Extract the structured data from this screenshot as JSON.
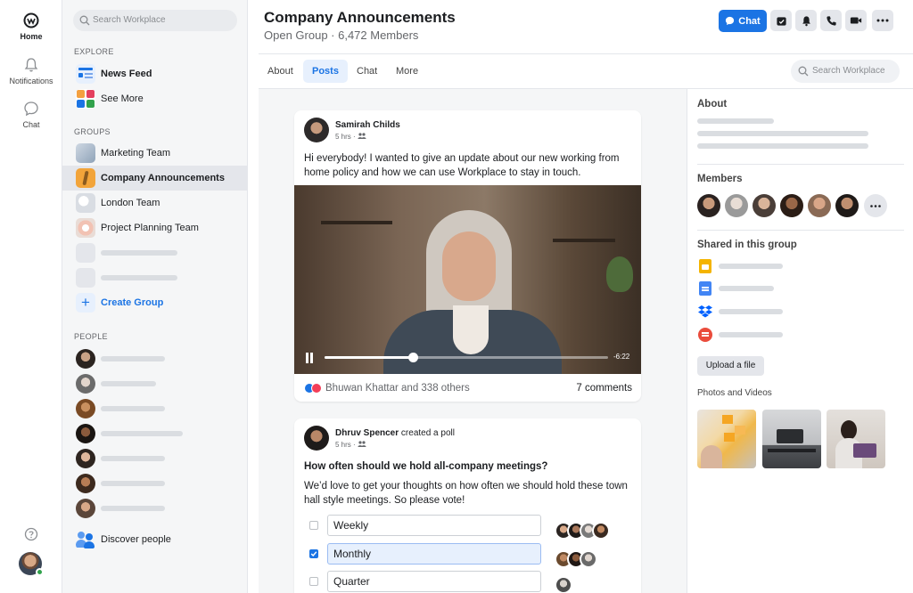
{
  "rail": {
    "home": "Home",
    "notifications": "Notifications",
    "chat": "Chat"
  },
  "sidebar": {
    "search_placeholder": "Search Workplace",
    "explore_heading": "EXPLORE",
    "news_feed": "News Feed",
    "see_more": "See More",
    "groups_heading": "GROUPS",
    "groups": [
      "Marketing Team",
      "Company Announcements",
      "London Team",
      "Project Planning Team"
    ],
    "create_group": "Create Group",
    "people_heading": "PEOPLE",
    "discover_people": "Discover people"
  },
  "header": {
    "title": "Company Announcements",
    "subtitle": "Open Group · 6,472 Members",
    "chat_button": "Chat"
  },
  "tabs": {
    "items": [
      "About",
      "Posts",
      "Chat",
      "More"
    ],
    "active": "Posts",
    "search_placeholder": "Search Workplace"
  },
  "post1": {
    "author": "Samirah Childs",
    "time": "5 hrs ·",
    "text": "Hi everybody! I wanted to give an update about our new working from home policy and how we can use Workplace to stay in touch.",
    "video_time": "-6:22",
    "video_progress": 0.31,
    "reactions": "Bhuwan Khattar and 338 others",
    "comments": "7 comments"
  },
  "post2": {
    "author": "Dhruv Spencer",
    "action": "created a poll",
    "time": "5 hrs ·",
    "question": "How often should we hold all-company meetings?",
    "text": "We’d love to get your thoughts on how often we should hold these town hall style meetings. So please vote!",
    "options": [
      {
        "label": "Weekly",
        "checked": false
      },
      {
        "label": "Monthly",
        "checked": true
      },
      {
        "label": "Quarter",
        "checked": false
      }
    ]
  },
  "right": {
    "about_heading": "About",
    "members_heading": "Members",
    "shared_heading": "Shared in this group",
    "upload_button": "Upload a file",
    "photos_heading": "Photos and Videos"
  },
  "colors": {
    "accent": "#1b74e4",
    "sidebar_bg": "#f5f6f7",
    "online": "#31a24c"
  },
  "icons": [
    "workplace-logo-icon",
    "bell-icon",
    "chat-bubble-icon",
    "search-icon",
    "help-icon",
    "calendar-icon",
    "phone-icon",
    "video-icon",
    "more-icon",
    "pause-icon",
    "people-icon"
  ]
}
